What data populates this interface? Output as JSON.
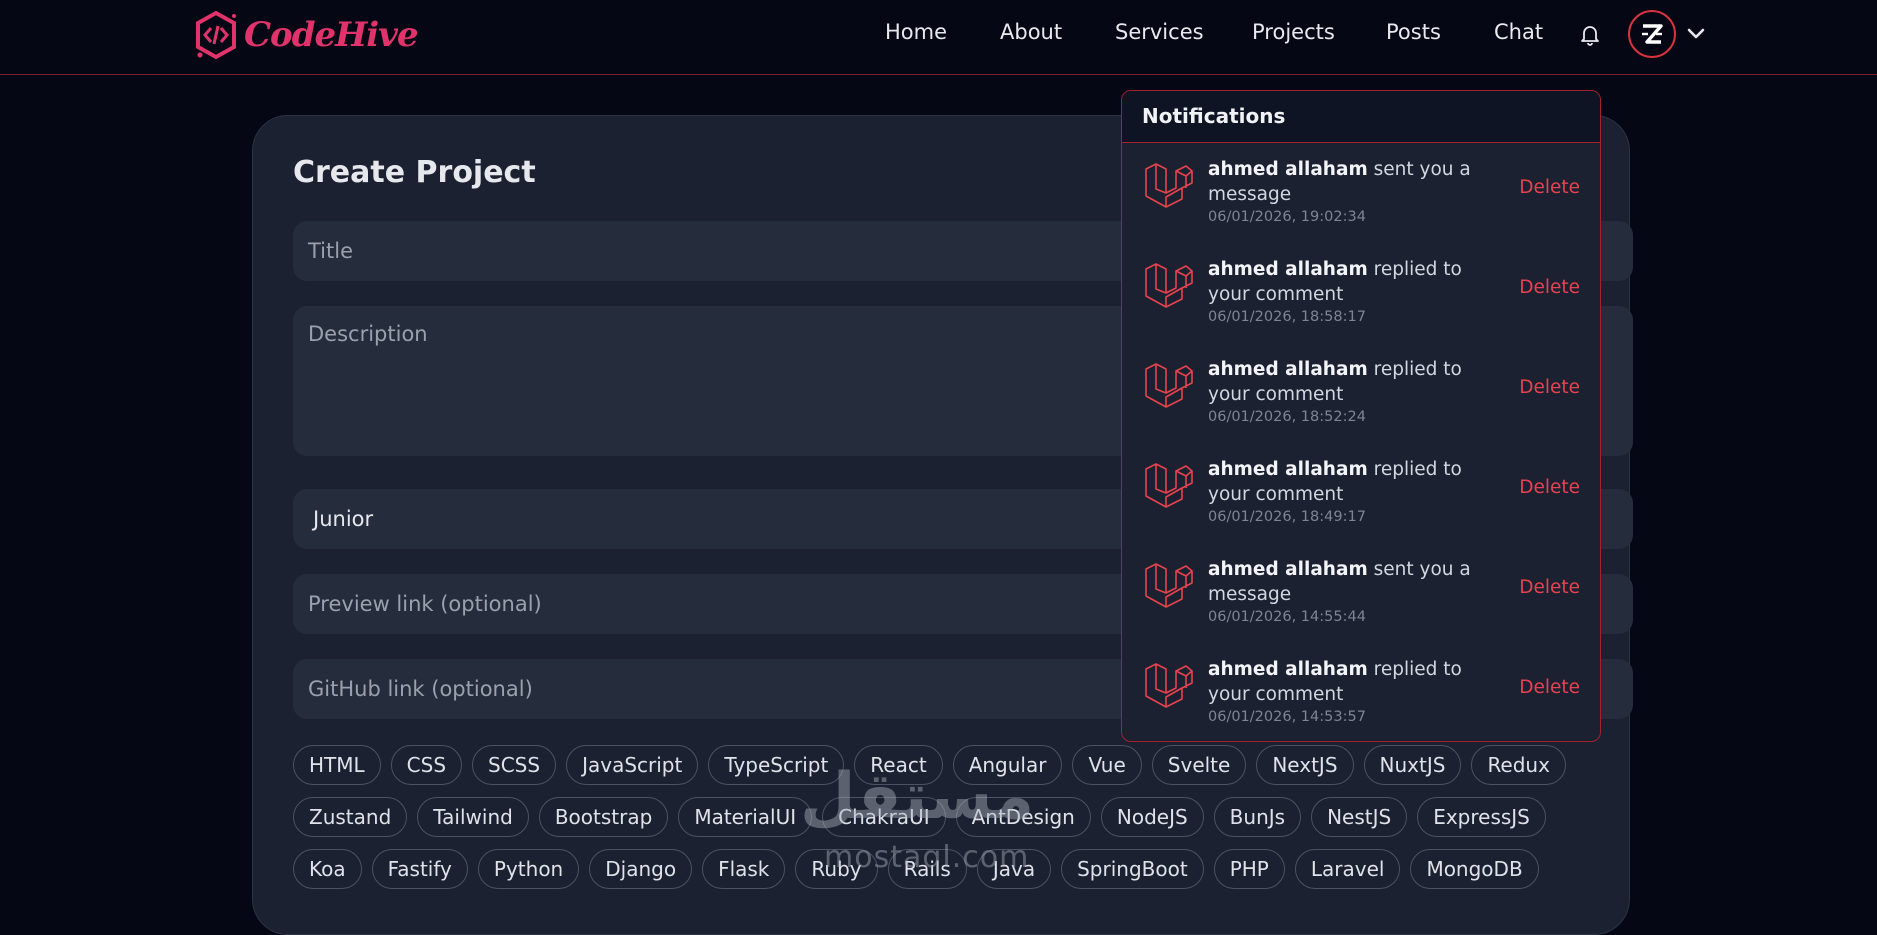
{
  "brand": {
    "name": "CodeHive"
  },
  "nav": {
    "items": [
      "Home",
      "About",
      "Services",
      "Projects",
      "Posts",
      "Chat"
    ]
  },
  "user": {
    "avatar_initial": "Z"
  },
  "form": {
    "title": "Create Project",
    "title_placeholder": "Title",
    "description_placeholder": "Description",
    "level_value": "Junior",
    "preview_placeholder": "Preview link (optional)",
    "github_placeholder": "GitHub link (optional)"
  },
  "tags": {
    "row1": [
      "HTML",
      "CSS",
      "SCSS",
      "JavaScript",
      "TypeScript",
      "React",
      "Angular",
      "Vue",
      "Svelte",
      "NextJS",
      "NuxtJS",
      "Redux"
    ],
    "row2": [
      "Zustand",
      "Tailwind",
      "Bootstrap",
      "MaterialUI",
      "ChakraUI",
      "AntDesign",
      "NodeJS",
      "BunJs",
      "NestJS",
      "ExpressJS"
    ],
    "row3": [
      "Koa",
      "Fastify",
      "Python",
      "Django",
      "Flask",
      "Ruby",
      "Rails",
      "Java",
      "SpringBoot",
      "PHP",
      "Laravel",
      "MongoDB"
    ]
  },
  "notifications": {
    "title": "Notifications",
    "delete_label": "Delete",
    "items": [
      {
        "user": "ahmed allaham",
        "action": "sent you a message",
        "time": "06/01/2026, 19:02:34"
      },
      {
        "user": "ahmed allaham",
        "action": "replied to your comment",
        "time": "06/01/2026, 18:58:17"
      },
      {
        "user": "ahmed allaham",
        "action": "replied to your comment",
        "time": "06/01/2026, 18:52:24"
      },
      {
        "user": "ahmed allaham",
        "action": "replied to your comment",
        "time": "06/01/2026, 18:49:17"
      },
      {
        "user": "ahmed allaham",
        "action": "sent you a message",
        "time": "06/01/2026, 14:55:44"
      },
      {
        "user": "ahmed allaham",
        "action": "replied to your comment",
        "time": "06/01/2026, 14:53:57"
      }
    ]
  },
  "watermark": {
    "arabic": "مستقل",
    "latin": "mostaql.com"
  },
  "colors": {
    "accent": "#e8424f",
    "brand": "#e0336b",
    "background": "#050814",
    "card": "#1b2130"
  }
}
